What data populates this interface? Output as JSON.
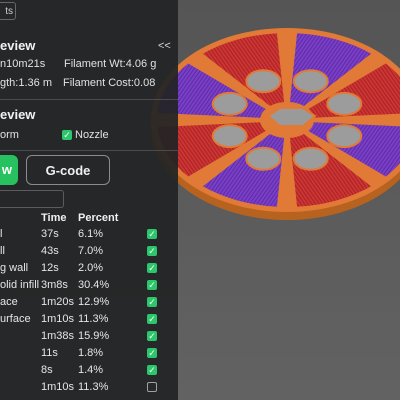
{
  "colors": {
    "accent_green": "#27c15f",
    "infill_purple": "#7a3fc8",
    "wall_red": "#cc3333",
    "perimeter_orange": "#e07a36",
    "panel_bg": "#212325"
  },
  "panel": {
    "top_box_text": "ts",
    "collapse_icon": "<<",
    "section1_title": "eview",
    "time_line": "n10m21s",
    "filament_weight": "Filament Wt:4.06 g",
    "length_line": "gth:1.36 m",
    "filament_cost": "Filament Cost:0.08",
    "section2_title": "eview",
    "legend_form": "orm",
    "legend_nozzle": "Nozzle",
    "preview_button": "w",
    "gcode_button": "G-code"
  },
  "table": {
    "headers": [
      "Time",
      "Percent"
    ],
    "rows": [
      {
        "name": "l",
        "time": "37s",
        "percent": "6.1%",
        "checked": true
      },
      {
        "name": "ll",
        "time": "43s",
        "percent": "7.0%",
        "checked": true
      },
      {
        "name": "g wall",
        "time": "12s",
        "percent": "2.0%",
        "checked": true
      },
      {
        "name": "olid infill",
        "time": "3m8s",
        "percent": "30.4%",
        "checked": true
      },
      {
        "name": "ace",
        "time": "1m20s",
        "percent": "12.9%",
        "checked": true
      },
      {
        "name": "urface",
        "time": "1m10s",
        "percent": "11.3%",
        "checked": true
      },
      {
        "name": "",
        "time": "1m38s",
        "percent": "15.9%",
        "checked": true
      },
      {
        "name": "",
        "time": "11s",
        "percent": "1.8%",
        "checked": true
      },
      {
        "name": "",
        "time": "8s",
        "percent": "1.4%",
        "checked": true
      },
      {
        "name": "",
        "time": "1m10s",
        "percent": "11.3%",
        "checked": false
      }
    ]
  }
}
